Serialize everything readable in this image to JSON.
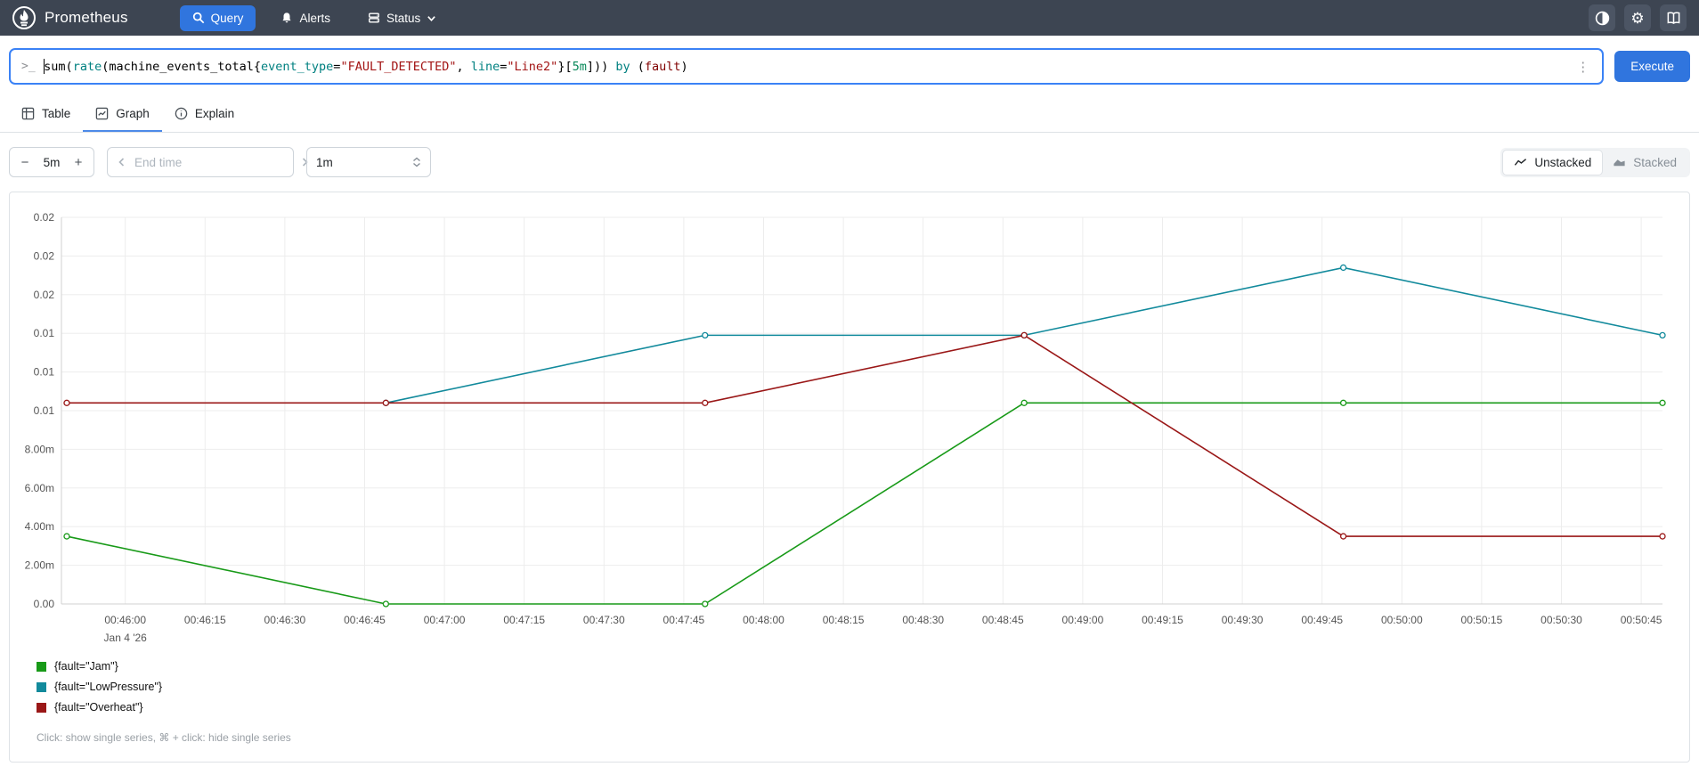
{
  "navbar": {
    "brand": "Prometheus",
    "items": [
      {
        "label": "Query",
        "icon": "search-icon",
        "active": true
      },
      {
        "label": "Alerts",
        "icon": "bell-icon",
        "active": false
      },
      {
        "label": "Status",
        "icon": "server-icon",
        "active": false,
        "has_dropdown": true
      }
    ],
    "icon_buttons": [
      "theme-toggle-icon",
      "settings-gear-icon",
      "docs-book-icon"
    ],
    "gear_glyph": "⚙"
  },
  "query": {
    "prompt_glyph": ">_",
    "tokens": [
      {
        "text": "sum",
        "color": "#000000"
      },
      {
        "text": "(",
        "color": "#000000"
      },
      {
        "text": "rate",
        "color": "#008080"
      },
      {
        "text": "(machine_events_total{",
        "color": "#000000"
      },
      {
        "text": "event_type",
        "color": "#008080"
      },
      {
        "text": "=",
        "color": "#000000"
      },
      {
        "text": "\"FAULT_DETECTED\"",
        "color": "#a31515"
      },
      {
        "text": ", ",
        "color": "#000000"
      },
      {
        "text": "line",
        "color": "#008080"
      },
      {
        "text": "=",
        "color": "#000000"
      },
      {
        "text": "\"Line2\"",
        "color": "#a31515"
      },
      {
        "text": "}[",
        "color": "#000000"
      },
      {
        "text": "5m",
        "color": "#09885a"
      },
      {
        "text": "])) ",
        "color": "#000000"
      },
      {
        "text": "by",
        "color": "#008080"
      },
      {
        "text": " (",
        "color": "#000000"
      },
      {
        "text": "fault",
        "color": "#800000"
      },
      {
        "text": ")",
        "color": "#000000"
      }
    ],
    "kebab_glyph": "⋮",
    "execute_label": "Execute"
  },
  "tabs": [
    {
      "label": "Table",
      "icon": "table-icon",
      "active": false
    },
    {
      "label": "Graph",
      "icon": "graph-icon",
      "active": true
    },
    {
      "label": "Explain",
      "icon": "info-icon",
      "active": false
    }
  ],
  "controls": {
    "range": {
      "decrease": "−",
      "value": "5m",
      "increase": "+"
    },
    "end_time_placeholder": "End time",
    "resolution": "1m",
    "stacking": [
      {
        "label": "Unstacked",
        "icon": "line-chart-icon",
        "active": true
      },
      {
        "label": "Stacked",
        "icon": "area-chart-icon",
        "active": false
      }
    ]
  },
  "colors": {
    "accent": "#3075de",
    "navbar_bg": "#3d4552",
    "grid": "#ededed",
    "axis": "#d0d0d0",
    "tick_text": "#555555"
  },
  "chart_data": {
    "type": "line",
    "title": "",
    "xlabel": "",
    "ylabel": "",
    "ylim": [
      0,
      0.02
    ],
    "x_domain": [
      "00:45:48",
      "00:50:49"
    ],
    "grid": true,
    "legend_position": "bottom-left",
    "y_ticks": [
      {
        "v": 0.0,
        "label": "0.00"
      },
      {
        "v": 0.002,
        "label": "2.00m"
      },
      {
        "v": 0.004,
        "label": "4.00m"
      },
      {
        "v": 0.006,
        "label": "6.00m"
      },
      {
        "v": 0.008,
        "label": "8.00m"
      },
      {
        "v": 0.01,
        "label": "0.01"
      },
      {
        "v": 0.012,
        "label": "0.01"
      },
      {
        "v": 0.014,
        "label": "0.01"
      },
      {
        "v": 0.016,
        "label": "0.02"
      },
      {
        "v": 0.018,
        "label": "0.02"
      },
      {
        "v": 0.02,
        "label": "0.02"
      }
    ],
    "x_ticks": [
      "00:46:00",
      "00:46:15",
      "00:46:30",
      "00:46:45",
      "00:47:00",
      "00:47:15",
      "00:47:30",
      "00:47:45",
      "00:48:00",
      "00:48:15",
      "00:48:30",
      "00:48:45",
      "00:49:00",
      "00:49:15",
      "00:49:30",
      "00:49:45",
      "00:50:00",
      "00:50:15",
      "00:50:30",
      "00:50:45"
    ],
    "x_date_label": "Jan 4 '26",
    "series": [
      {
        "name": "{fault=\"Jam\"}",
        "color": "#189a18",
        "x": [
          "00:45:49",
          "00:46:49",
          "00:47:49",
          "00:48:49",
          "00:49:49",
          "00:50:49"
        ],
        "values": [
          0.0035,
          0.0,
          0.0,
          0.0104,
          0.0104,
          0.0104
        ]
      },
      {
        "name": "{fault=\"LowPressure\"}",
        "color": "#128a9c",
        "x": [
          "00:46:49",
          "00:47:49",
          "00:48:49",
          "00:49:49",
          "00:50:49"
        ],
        "values": [
          0.0104,
          0.0139,
          0.0139,
          0.0174,
          0.0139
        ]
      },
      {
        "name": "{fault=\"Overheat\"}",
        "color": "#9a1717",
        "x": [
          "00:45:49",
          "00:46:49",
          "00:47:49",
          "00:48:49",
          "00:49:49",
          "00:50:49"
        ],
        "values": [
          0.0104,
          0.0104,
          0.0104,
          0.0139,
          0.0035,
          0.0035
        ]
      }
    ]
  },
  "footer_note": "Click: show single series, ⌘ + click: hide single series"
}
